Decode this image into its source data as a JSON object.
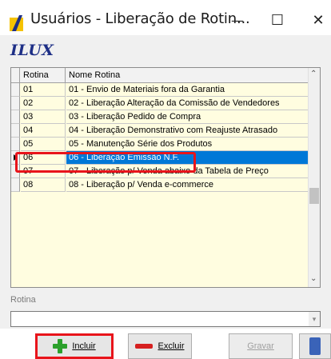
{
  "window": {
    "title": "Usuários - Liberação de Rotin...",
    "minimize_glyph": "—",
    "maximize_glyph": "☐",
    "close_glyph": "✕"
  },
  "brand": "ILUX",
  "grid": {
    "headers": [
      "Rotina",
      "Nome Rotina"
    ],
    "rows": [
      {
        "rotina": "01",
        "nome": "01 - Envio de Materiais fora da Garantia"
      },
      {
        "rotina": "02",
        "nome": "02 - Liberação Alteração da Comissão de Vendedores"
      },
      {
        "rotina": "03",
        "nome": "03 - Liberação Pedido de Compra"
      },
      {
        "rotina": "04",
        "nome": "04 - Liberação Demonstrativo com Reajuste Atrasado"
      },
      {
        "rotina": "05",
        "nome": "05 - Manutenção Série dos Produtos"
      },
      {
        "rotina": "06",
        "nome": "06 - Liberação Emissão N.F."
      },
      {
        "rotina": "07",
        "nome": "07 - Liberação p/ Venda abaixo da Tabela de Preço"
      },
      {
        "rotina": "08",
        "nome": "08 - Liberação p/ Venda e-commerce"
      }
    ],
    "selected_rotina": "06"
  },
  "field": {
    "label": "Rotina",
    "value": ""
  },
  "buttons": {
    "incluir": "Incluir",
    "excluir": "Excluir",
    "gravar": "Gravar"
  },
  "colors": {
    "selection": "#0078d7",
    "grid_background": "#fffde0",
    "highlight": "#e8141b",
    "brand": "#1e2f86"
  }
}
